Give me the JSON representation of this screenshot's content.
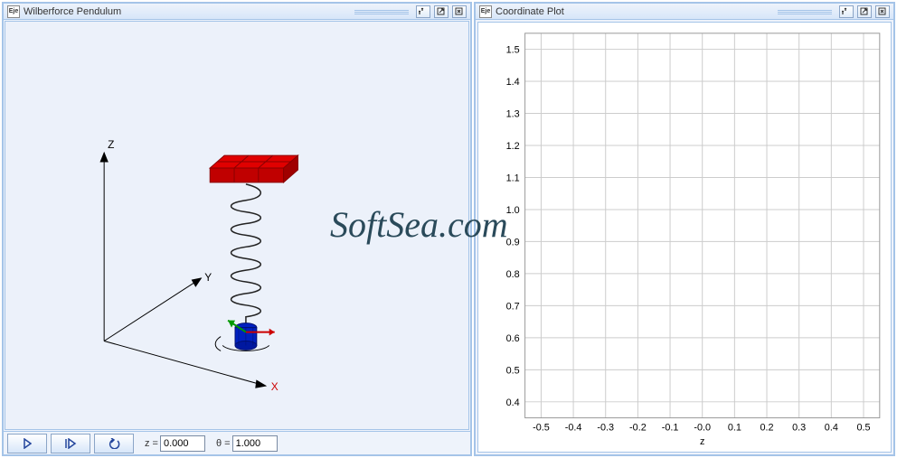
{
  "left_window": {
    "title": "Wilberforce Pendulum",
    "app_icon": "Eje",
    "axes": {
      "x": "X",
      "y": "Y",
      "z": "Z"
    },
    "toolbar": {
      "z_label": "z =",
      "z_value": "0.000",
      "theta_label": "θ =",
      "theta_value": "1.000"
    }
  },
  "right_window": {
    "title": "Coordinate Plot",
    "app_icon": "Eje"
  },
  "chart_data": {
    "type": "line",
    "title": "",
    "xlabel": "z",
    "ylabel": "",
    "xlim": [
      -0.55,
      0.55
    ],
    "ylim": [
      0.35,
      1.55
    ],
    "x_ticks": [
      -0.5,
      -0.4,
      -0.3,
      -0.2,
      -0.1,
      -0.0,
      0.1,
      0.2,
      0.3,
      0.4,
      0.5
    ],
    "y_ticks": [
      0.4,
      0.5,
      0.6,
      0.7,
      0.8,
      0.9,
      1.0,
      1.1,
      1.2,
      1.3,
      1.4,
      1.5
    ],
    "series": []
  },
  "watermark": "SoftSea.com"
}
